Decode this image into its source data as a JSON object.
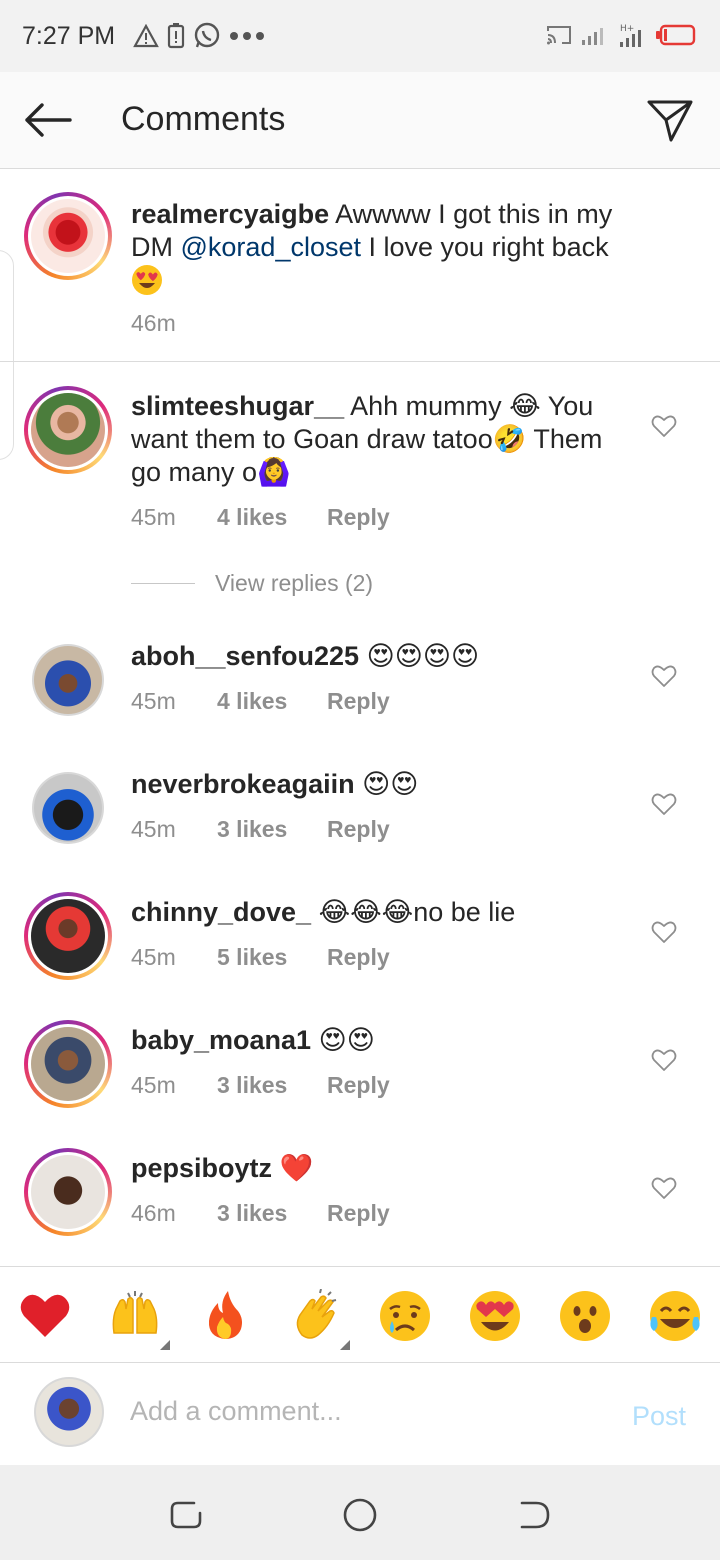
{
  "status_bar": {
    "time": "7:27 PM"
  },
  "header": {
    "title": "Comments"
  },
  "caption": {
    "username": "realmercyaigbe",
    "text_before_mention": " Awwww I got this in my DM ",
    "mention": "@korad_closet",
    "text_after_mention": " I love you right back",
    "time": "46m"
  },
  "comments": [
    {
      "username": "slimteeshugar__",
      "text": " Ahh mummy 😂 You want them to Goan draw tatoo🤣 Them go many o🙆‍♀️",
      "time": "45m",
      "likes": "4 likes",
      "reply": "Reply"
    },
    {
      "username": "aboh__senfou225",
      "text": " 😍😍😍😍",
      "time": "45m",
      "likes": "4 likes",
      "reply": "Reply"
    },
    {
      "username": "neverbrokeagaiin",
      "text": " 😍😍",
      "time": "45m",
      "likes": "3 likes",
      "reply": "Reply"
    },
    {
      "username": "chinny_dove_",
      "text": " 😂😂😂no be lie",
      "time": "45m",
      "likes": "5 likes",
      "reply": "Reply"
    },
    {
      "username": "baby_moana1",
      "text": " 😍😍",
      "time": "45m",
      "likes": "3 likes",
      "reply": "Reply"
    },
    {
      "username": "pepsiboytz",
      "text": " ❤️",
      "time": "46m",
      "likes": "3 likes",
      "reply": "Reply"
    }
  ],
  "view_replies": "View replies (2)",
  "reactions": [
    "red-heart",
    "raising-hands",
    "fire",
    "clapping-hands",
    "crying-face",
    "heart-eyes",
    "surprised-face",
    "tears-of-joy"
  ],
  "composer": {
    "placeholder": "Add a comment...",
    "post_label": "Post"
  },
  "colors": {
    "accent_disabled": "#b2dffc",
    "mention": "#00376b",
    "meta": "#8e8e8e"
  }
}
